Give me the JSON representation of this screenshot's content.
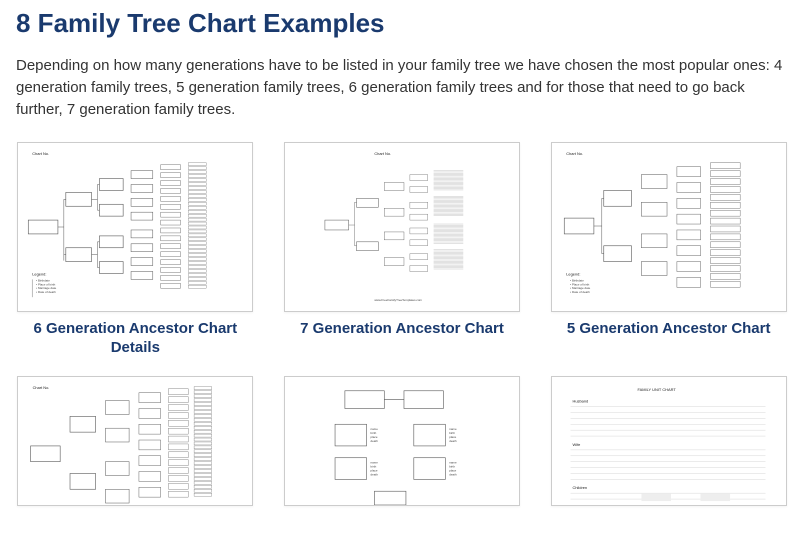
{
  "heading": "8 Family Tree Chart Examples",
  "intro": "Depending on how many generations have to be listed in your family tree we have chosen the most popular ones: 4 generation family trees, 5 generation family trees, 6 generation family trees and for those that need to go back further, 7 generation family trees.",
  "examples": [
    {
      "caption": "6 Generation Ancestor Chart Details"
    },
    {
      "caption": "7 Generation Ancestor Chart"
    },
    {
      "caption": "5 Generation Ancestor Chart"
    },
    {
      "caption": ""
    },
    {
      "caption": ""
    },
    {
      "caption": ""
    }
  ],
  "thumb_labels": {
    "chart_no": "Chart No.",
    "legend": "Legend:",
    "family_unit": "FAMILY UNIT CHART",
    "husband": "Husband",
    "wife": "Wife",
    "children": "Children"
  }
}
